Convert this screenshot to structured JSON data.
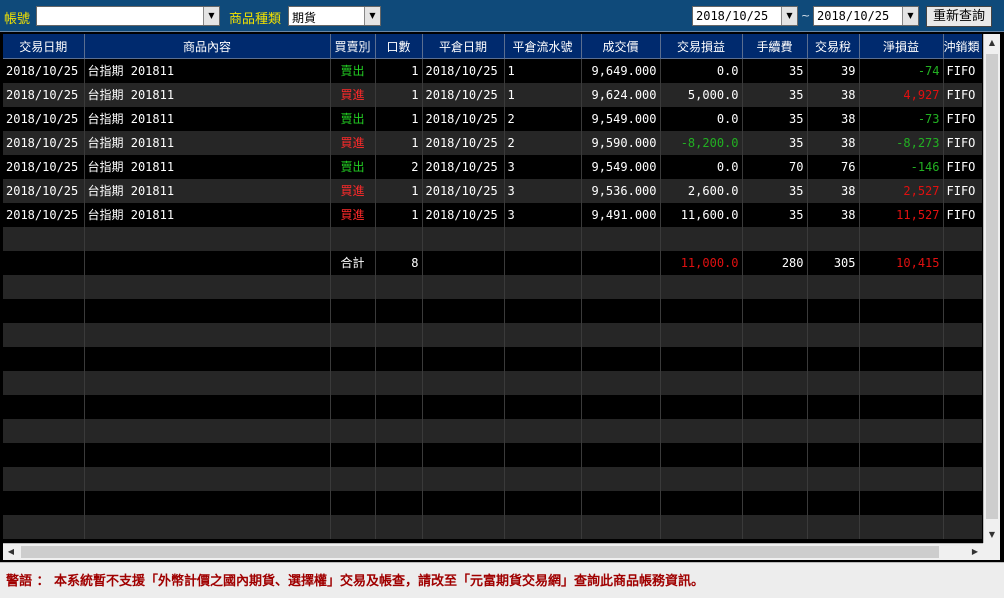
{
  "toolbar": {
    "account_label": "帳號",
    "account_value": "",
    "product_type_label": "商品種類",
    "product_type_value": "期貨",
    "date_from": "2018/10/25",
    "date_sep": "~",
    "date_to": "2018/10/25",
    "query_button": "重新查詢"
  },
  "table": {
    "headers": [
      "交易日期",
      "商品內容",
      "買賣別",
      "口數",
      "平倉日期",
      "平倉流水號",
      "成交價",
      "交易損益",
      "手續費",
      "交易稅",
      "淨損益",
      "沖銷類"
    ],
    "rows": [
      [
        "2018/10/25",
        "台指期 201811",
        "賣出",
        "1",
        "2018/10/25",
        "1",
        "9,649.000",
        "0.0",
        "35",
        "39",
        "-74",
        "FIFO"
      ],
      [
        "2018/10/25",
        "台指期 201811",
        "買進",
        "1",
        "2018/10/25",
        "1",
        "9,624.000",
        "5,000.0",
        "35",
        "38",
        "4,927",
        "FIFO"
      ],
      [
        "2018/10/25",
        "台指期 201811",
        "賣出",
        "1",
        "2018/10/25",
        "2",
        "9,549.000",
        "0.0",
        "35",
        "38",
        "-73",
        "FIFO"
      ],
      [
        "2018/10/25",
        "台指期 201811",
        "買進",
        "1",
        "2018/10/25",
        "2",
        "9,590.000",
        "-8,200.0",
        "35",
        "38",
        "-8,273",
        "FIFO"
      ],
      [
        "2018/10/25",
        "台指期 201811",
        "賣出",
        "2",
        "2018/10/25",
        "3",
        "9,549.000",
        "0.0",
        "70",
        "76",
        "-146",
        "FIFO"
      ],
      [
        "2018/10/25",
        "台指期 201811",
        "買進",
        "1",
        "2018/10/25",
        "3",
        "9,536.000",
        "2,600.0",
        "35",
        "38",
        "2,527",
        "FIFO"
      ],
      [
        "2018/10/25",
        "台指期 201811",
        "買進",
        "1",
        "2018/10/25",
        "3",
        "9,491.000",
        "11,600.0",
        "35",
        "38",
        "11,527",
        "FIFO"
      ]
    ],
    "total": {
      "label": "合計",
      "qty": "8",
      "pnl": "11,000.0",
      "fee": "280",
      "tax": "305",
      "net": "10,415"
    }
  },
  "warning": "警語 ： 本系統暫不支援「外幣計價之國內期貨、選擇權」交易及帳查，請改至「元富期貨交易網」查詢此商品帳務資訊。",
  "colors": {
    "header_bg": "#002a6e",
    "toolbar_bg": "#0f4a7a",
    "label_yellow": "#f2e200",
    "profit_red": "#e01010",
    "loss_green": "#22b022",
    "warning_text": "#a00000"
  },
  "icons": {
    "dropdown": "chevron-down-icon",
    "scroll_up": "arrow-up-icon",
    "scroll_down": "arrow-down-icon",
    "scroll_left": "arrow-left-icon",
    "scroll_right": "arrow-right-icon"
  }
}
